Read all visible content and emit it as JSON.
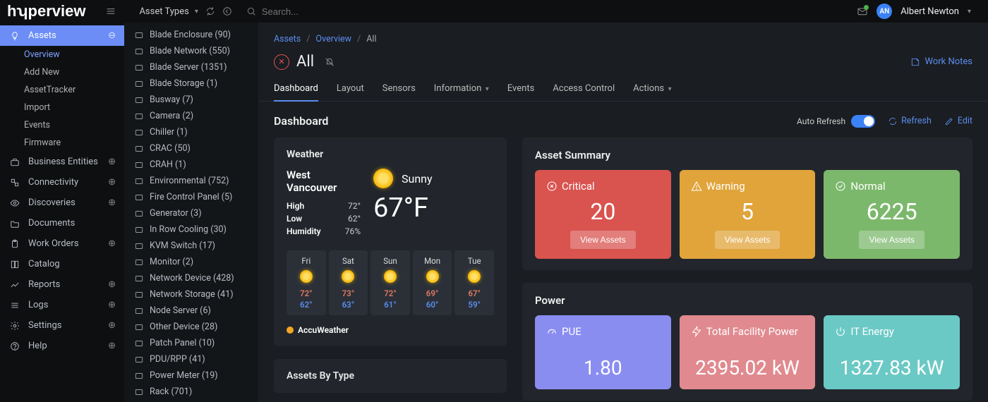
{
  "brand": "hyperview",
  "panel_title": "Asset Types",
  "search_placeholder": "Search...",
  "user": {
    "initials": "AN",
    "name": "Albert Newton"
  },
  "nav": {
    "assets": "Assets",
    "subs": [
      "Overview",
      "Add New",
      "AssetTracker",
      "Import",
      "Events",
      "Firmware"
    ],
    "items": [
      {
        "label": "Business Entities"
      },
      {
        "label": "Connectivity"
      },
      {
        "label": "Discoveries"
      },
      {
        "label": "Documents"
      },
      {
        "label": "Work Orders"
      },
      {
        "label": "Catalog"
      },
      {
        "label": "Reports"
      },
      {
        "label": "Logs"
      },
      {
        "label": "Settings"
      },
      {
        "label": "Help"
      }
    ]
  },
  "asset_types": [
    {
      "label": "Blade Enclosure (90)"
    },
    {
      "label": "Blade Network (550)"
    },
    {
      "label": "Blade Server (1351)"
    },
    {
      "label": "Blade Storage (1)"
    },
    {
      "label": "Busway (7)"
    },
    {
      "label": "Camera (2)"
    },
    {
      "label": "Chiller (1)"
    },
    {
      "label": "CRAC (50)"
    },
    {
      "label": "CRAH (1)"
    },
    {
      "label": "Environmental (752)"
    },
    {
      "label": "Fire Control Panel (5)"
    },
    {
      "label": "Generator (3)"
    },
    {
      "label": "In Row Cooling (30)"
    },
    {
      "label": "KVM Switch (17)"
    },
    {
      "label": "Monitor (2)"
    },
    {
      "label": "Network Device (428)"
    },
    {
      "label": "Network Storage (41)"
    },
    {
      "label": "Node Server (6)"
    },
    {
      "label": "Other Device (28)"
    },
    {
      "label": "Patch Panel (10)"
    },
    {
      "label": "PDU/RPP (41)"
    },
    {
      "label": "Power Meter (19)"
    },
    {
      "label": "Rack (701)"
    }
  ],
  "breadcrumb": {
    "a": "Assets",
    "b": "Overview",
    "c": "All"
  },
  "page_title": "All",
  "work_notes": "Work Notes",
  "tabs": [
    "Dashboard",
    "Layout",
    "Sensors",
    "Information",
    "Events",
    "Access Control",
    "Actions"
  ],
  "section": {
    "title": "Dashboard",
    "auto_refresh": "Auto Refresh",
    "refresh": "Refresh",
    "edit": "Edit"
  },
  "weather": {
    "title": "Weather",
    "location": "West Vancouver",
    "condition": "Sunny",
    "temp": "67°F",
    "high_lab": "High",
    "high": "72°",
    "low_lab": "Low",
    "low": "62°",
    "hum_lab": "Humidity",
    "hum": "76%",
    "forecast": [
      {
        "d": "Fri",
        "hi": "72°",
        "lo": "62°"
      },
      {
        "d": "Sat",
        "hi": "73°",
        "lo": "63°"
      },
      {
        "d": "Sun",
        "hi": "72°",
        "lo": "61°"
      },
      {
        "d": "Mon",
        "hi": "69°",
        "lo": "60°"
      },
      {
        "d": "Tue",
        "hi": "67°",
        "lo": "59°"
      }
    ],
    "provider": "AccuWeather"
  },
  "assets_by_type_title": "Assets By Type",
  "asset_summary": {
    "title": "Asset Summary",
    "view": "View Assets",
    "critical": {
      "label": "Critical",
      "val": "20"
    },
    "warning": {
      "label": "Warning",
      "val": "5"
    },
    "normal": {
      "label": "Normal",
      "val": "6225"
    }
  },
  "power": {
    "title": "Power",
    "pue": {
      "label": "PUE",
      "val": "1.80"
    },
    "tfp": {
      "label": "Total Facility Power",
      "val": "2395.02 kW"
    },
    "ite": {
      "label": "IT Energy",
      "val": "1327.83 kW"
    }
  }
}
